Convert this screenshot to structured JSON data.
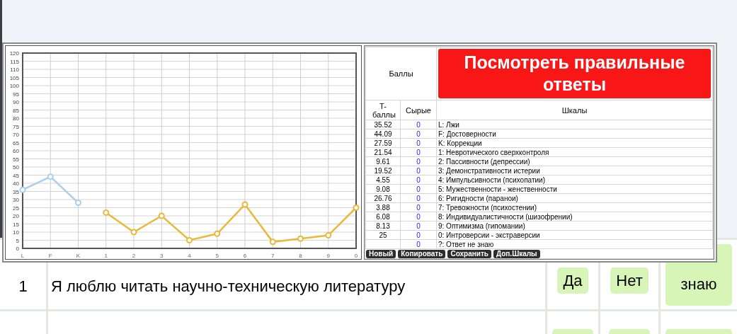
{
  "results_panel": {
    "scores_header": "Баллы",
    "answers_button": "Посмотреть правильные ответы",
    "columns": [
      "T-баллы",
      "Сырые",
      "Шкалы"
    ],
    "rows": [
      {
        "t_score": "35.52",
        "raw": "0",
        "scale": "L: Лжи"
      },
      {
        "t_score": "44.09",
        "raw": "0",
        "scale": "F: Достоверности"
      },
      {
        "t_score": "27.59",
        "raw": "0",
        "scale": "K: Коррекции"
      },
      {
        "t_score": "21.54",
        "raw": "0",
        "scale": "1: Невротического сверхконтроля"
      },
      {
        "t_score": "9.61",
        "raw": "0",
        "scale": "2: Пассивности (депрессии)"
      },
      {
        "t_score": "19.52",
        "raw": "0",
        "scale": "3: Демонстративности истерии"
      },
      {
        "t_score": "4.55",
        "raw": "0",
        "scale": "4: Импульсивности (психопатии)"
      },
      {
        "t_score": "9.08",
        "raw": "0",
        "scale": "5: Мужественности - женственности"
      },
      {
        "t_score": "26.76",
        "raw": "0",
        "scale": "6: Ригидности (паранои)"
      },
      {
        "t_score": "3.88",
        "raw": "0",
        "scale": "7: Тревожности (психостении)"
      },
      {
        "t_score": "6.08",
        "raw": "0",
        "scale": "8: Индивидуалистичности (шизофрении)"
      },
      {
        "t_score": "8.13",
        "raw": "0",
        "scale": "9: Оптимизма (гипомании)"
      },
      {
        "t_score": "25",
        "raw": "0",
        "scale": "0: Интроверсии - экстраверсии"
      },
      {
        "raw": "0",
        "scale": "?: Ответ не знаю"
      }
    ],
    "actions": [
      "Новый",
      "Копировать",
      "Сохранить",
      "Доп.Шкалы"
    ],
    "chart_data": {
      "type": "line",
      "categories": [
        "L",
        "F",
        "K",
        "1",
        "2",
        "3",
        "4",
        "5",
        "6",
        "7",
        "8",
        "9",
        "0"
      ],
      "ylim": [
        0,
        120
      ],
      "grid": true,
      "yticks": [
        0,
        5,
        10,
        15,
        20,
        25,
        30,
        35,
        40,
        45,
        50,
        55,
        60,
        65,
        70,
        75,
        80,
        85,
        90,
        95,
        100,
        105,
        110,
        115,
        120
      ],
      "series": [
        {
          "color": "#a9cfee",
          "marker": "circle",
          "values": [
            36,
            44,
            28,
            null,
            null,
            null,
            null,
            null,
            null,
            null,
            null,
            null,
            null
          ]
        },
        {
          "color": "#e8b93a",
          "marker": "circle",
          "values": [
            null,
            null,
            null,
            22,
            10,
            20,
            5,
            9,
            27,
            4,
            6,
            8,
            25
          ]
        }
      ]
    }
  },
  "questions": [
    {
      "number": "1",
      "text": "Я люблю читать научно-техническую литературу",
      "answers": [
        "Да",
        "Нет",
        "знаю"
      ]
    },
    {
      "kind": "cut_off"
    }
  ]
}
